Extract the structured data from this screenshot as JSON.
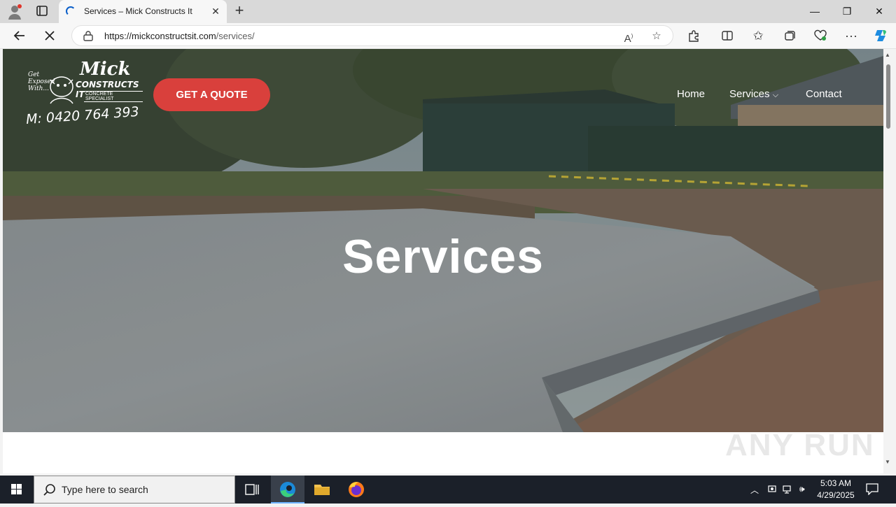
{
  "browser": {
    "tab_title": "Services – Mick Constructs It",
    "url_host": "https://mickconstructsit.com",
    "url_path": "/services/"
  },
  "site": {
    "logo_name": "Mick",
    "logo_company": "CONSTRUCTS IT",
    "logo_specialist": "CONCRETE SPECIALIST",
    "logo_tagline": "Get Exposed With...",
    "logo_phone": "M: 0420 764 393",
    "quote_button": "GET A QUOTE",
    "nav": [
      {
        "label": "Home"
      },
      {
        "label": "Services"
      },
      {
        "label": "Contact"
      }
    ],
    "hero_title": "Services"
  },
  "watermark": "ANY RUN",
  "taskbar": {
    "search_placeholder": "Type here to search",
    "time": "5:03 AM",
    "date": "4/29/2025"
  },
  "colors": {
    "accent_button": "#d9403c",
    "taskbar": "#1b2029",
    "edge_blue": "#0a5fc9"
  }
}
